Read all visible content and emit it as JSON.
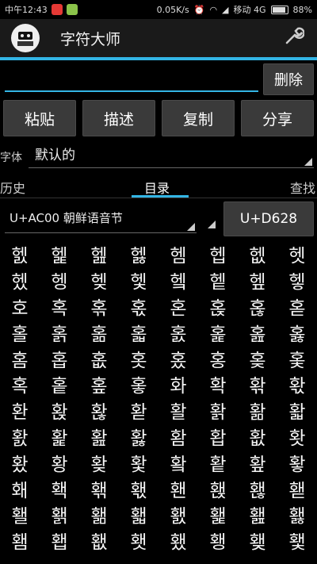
{
  "status_bar": {
    "time": "中午12:43",
    "network_speed": "0.05K/s",
    "carrier": "移动 4G",
    "battery": "88%"
  },
  "action_bar": {
    "app_icon_text": "字符大师",
    "title": "字符大师",
    "settings_icon": "wrench-icon"
  },
  "input": {
    "value": "",
    "delete_label": "删除"
  },
  "buttons": {
    "paste": "粘贴",
    "describe": "描述",
    "copy": "复制",
    "share": "分享"
  },
  "font": {
    "label": "字体",
    "value": "默认的"
  },
  "tabs": {
    "history": "历史",
    "directory": "目录",
    "search": "查找"
  },
  "block": {
    "value": "U+AC00 朝鲜语音节",
    "code_button": "U+D628"
  },
  "chars": [
    "헰",
    "헱",
    "헲",
    "헳",
    "헴",
    "헵",
    "헶",
    "헷",
    "헸",
    "헹",
    "헺",
    "헻",
    "헼",
    "헽",
    "헾",
    "헿",
    "호",
    "혹",
    "혺",
    "혻",
    "혼",
    "혽",
    "혾",
    "혿",
    "홀",
    "홁",
    "홂",
    "홃",
    "홄",
    "홅",
    "홆",
    "홇",
    "홈",
    "홉",
    "홊",
    "홋",
    "홌",
    "홍",
    "홎",
    "홏",
    "혹",
    "홑",
    "홒",
    "홓",
    "화",
    "확",
    "홖",
    "홗",
    "환",
    "홙",
    "홚",
    "홛",
    "활",
    "홝",
    "홞",
    "홟",
    "홠",
    "홡",
    "홢",
    "홣",
    "홤",
    "홥",
    "홦",
    "홧",
    "홨",
    "황",
    "홪",
    "홫",
    "홬",
    "홭",
    "홮",
    "홯",
    "홰",
    "홱",
    "홲",
    "홳",
    "홴",
    "홵",
    "홶",
    "홷",
    "홸",
    "홹",
    "홺",
    "홻",
    "홼",
    "홽",
    "홾",
    "홿",
    "횀",
    "횁",
    "횂",
    "횃",
    "횄",
    "횅",
    "횆",
    "횇"
  ]
}
